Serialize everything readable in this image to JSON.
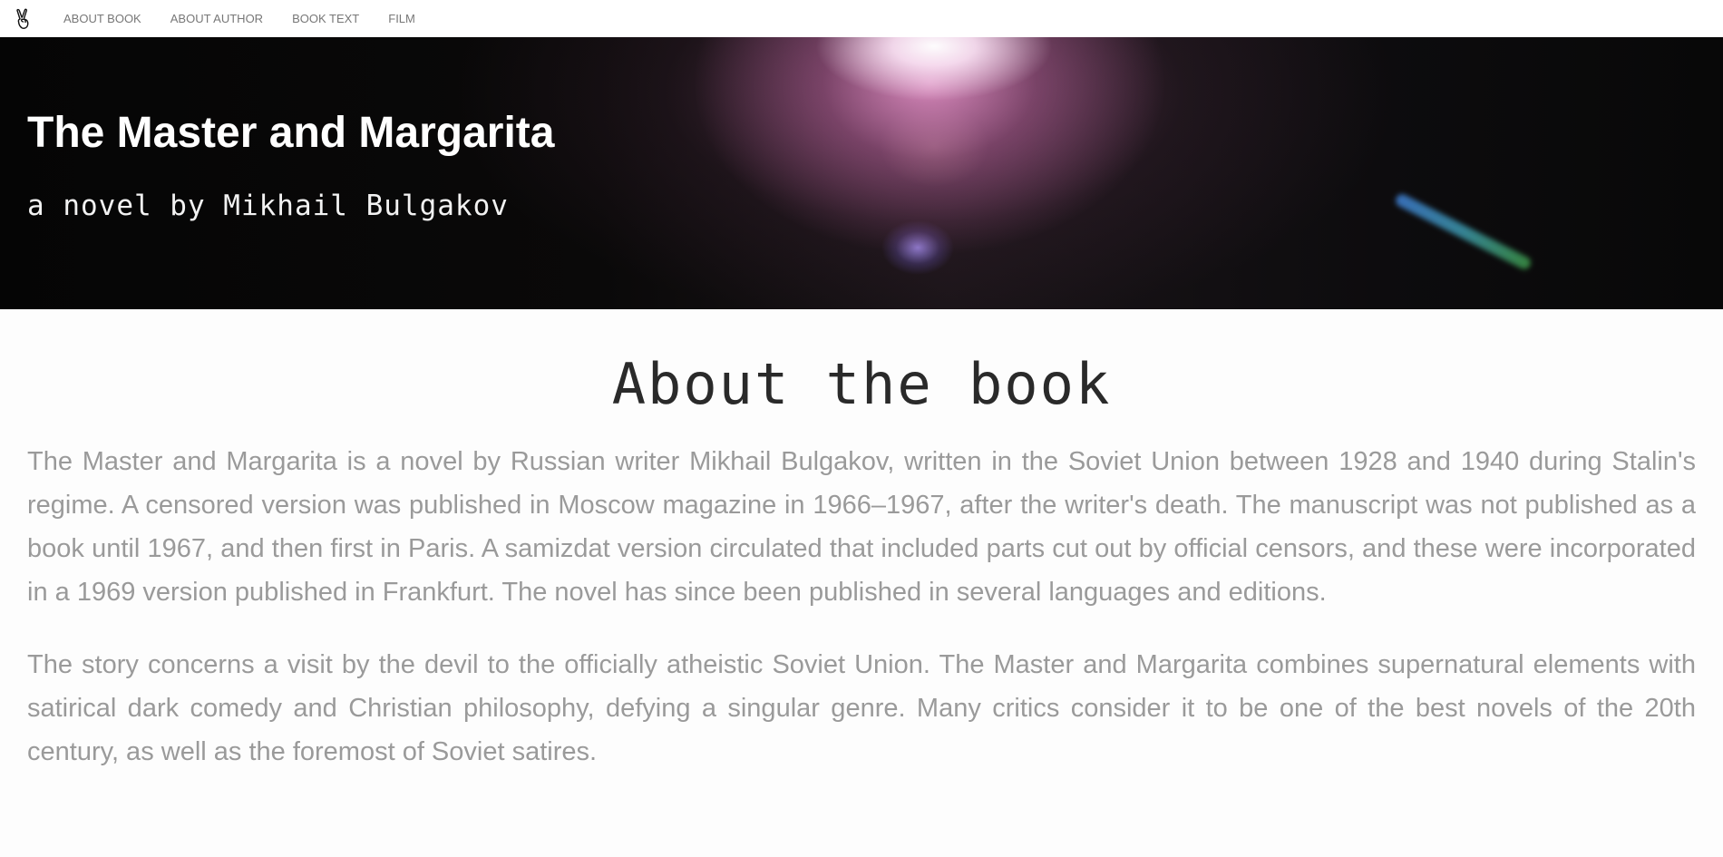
{
  "nav": {
    "brand_icon": "victory-hand-icon",
    "items": [
      {
        "label": "ABOUT BOOK"
      },
      {
        "label": "ABOUT AUTHOR"
      },
      {
        "label": "BOOK TEXT"
      },
      {
        "label": "FILM"
      }
    ]
  },
  "hero": {
    "title": "The Master and Margarita",
    "subtitle": "a novel by Mikhail Bulgakov"
  },
  "about": {
    "heading": "About the book",
    "paragraphs": [
      "The Master and Margarita is a novel by Russian writer Mikhail Bulgakov, written in the Soviet Union between 1928 and 1940 during Stalin's regime. A censored version was published in Moscow magazine in 1966–1967, after the writer's death. The manuscript was not published as a book until 1967, and then first in Paris. A samizdat version circulated that included parts cut out by official censors, and these were incorporated in a 1969 version published in Frankfurt. The novel has since been published in several languages and editions.",
      "The story concerns a visit by the devil to the officially atheistic Soviet Union. The Master and Margarita combines supernatural elements with satirical dark comedy and Christian philosophy, defying a singular genre. Many critics consider it to be one of the best novels of the 20th century, as well as the foremost of Soviet satires."
    ]
  },
  "colors": {
    "nav_text": "#777777",
    "hero_text": "#ffffff",
    "heading_text": "#2a2a2a",
    "body_text": "#9a9a9a",
    "page_background": "#fdfdfd"
  }
}
